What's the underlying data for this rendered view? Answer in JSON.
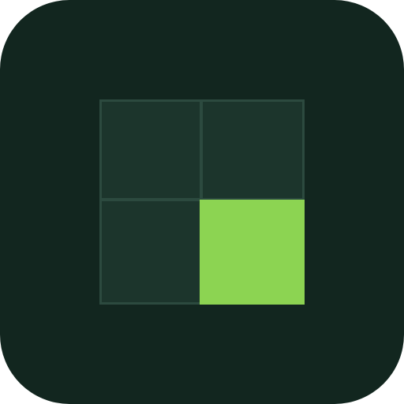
{
  "icon": {
    "name": "four-square-grid-app-icon",
    "background_color": "#12261f",
    "cell_fill_color": "#1c352c",
    "cell_border_color": "#2c4a3f",
    "highlight_color": "#8cd452",
    "cells": [
      {
        "id": "top-left",
        "highlighted": false
      },
      {
        "id": "top-right",
        "highlighted": false
      },
      {
        "id": "bottom-left",
        "highlighted": false
      },
      {
        "id": "bottom-right",
        "highlighted": true
      }
    ]
  }
}
